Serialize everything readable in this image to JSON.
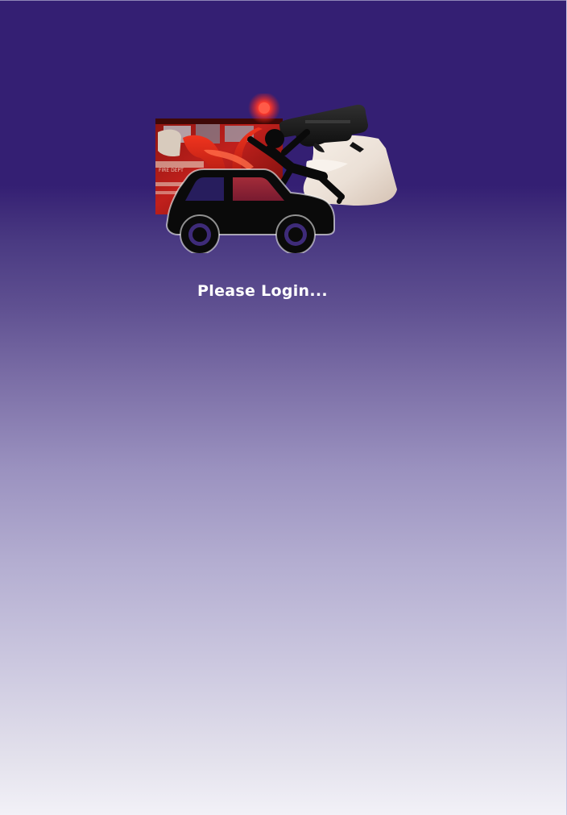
{
  "login": {
    "message": "Please Login..."
  },
  "theme": {
    "background_top": "#341f73",
    "background_bottom": "#f2f1f7",
    "text_color": "#ffffff"
  },
  "hero_image": {
    "icons": [
      "fire-truck",
      "car-icon",
      "pedestrian-icon",
      "handgun-icon"
    ]
  }
}
